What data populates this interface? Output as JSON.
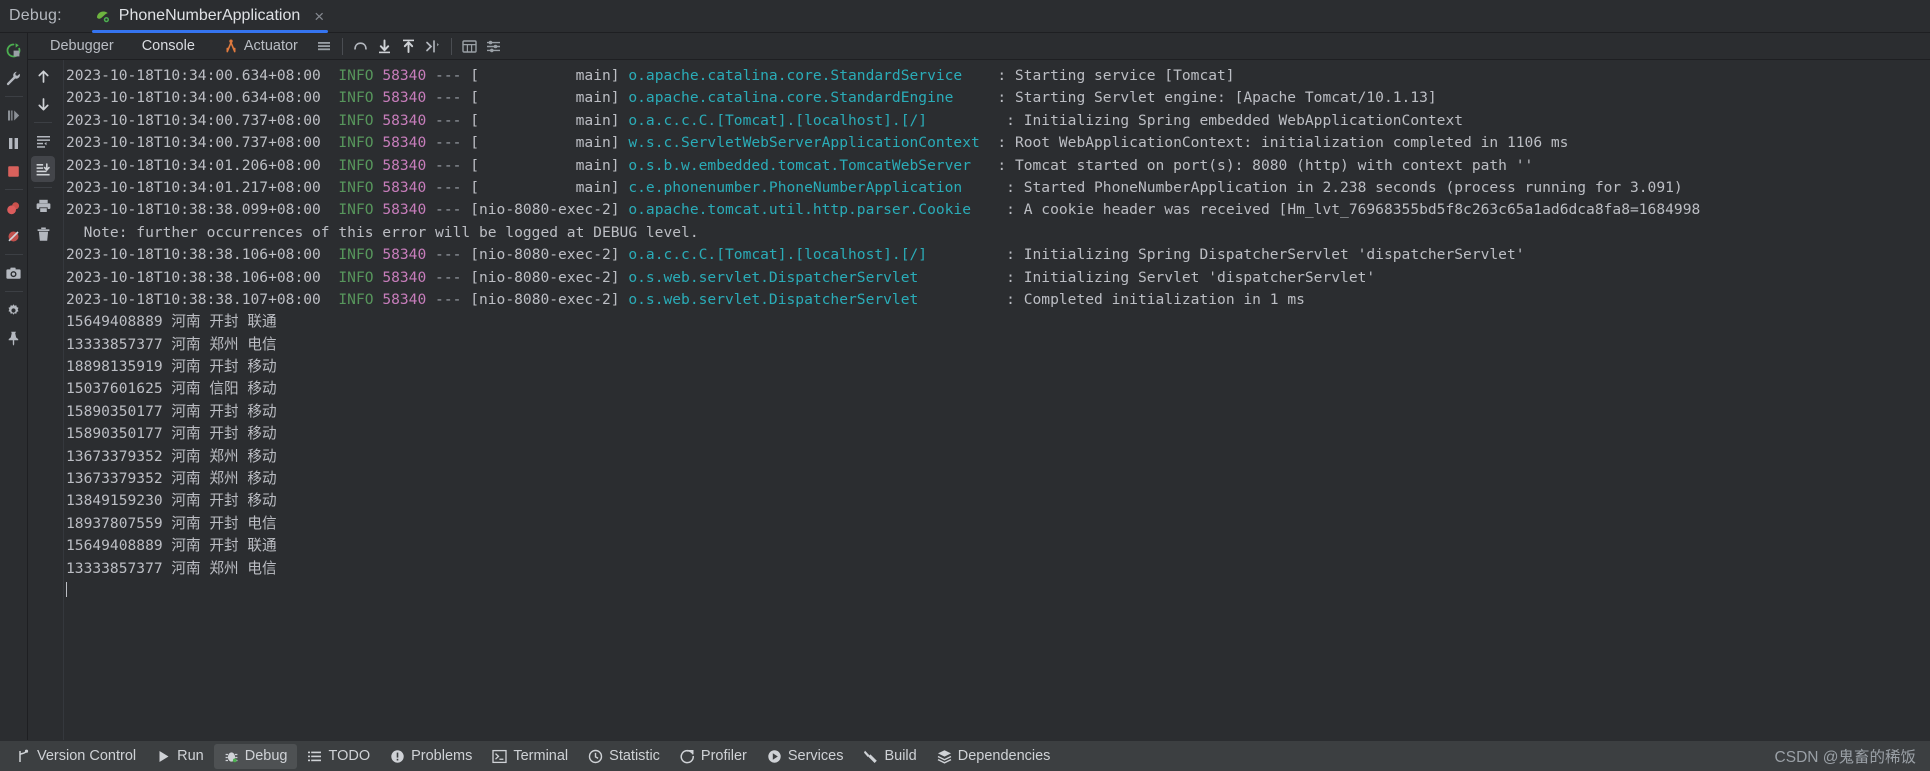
{
  "window": {
    "debug_label": "Debug:",
    "run_config_name": "PhoneNumberApplication",
    "close_glyph": "×"
  },
  "left_rail": {
    "items": [
      {
        "name": "rerun-debug-icon",
        "title": "Rerun"
      },
      {
        "name": "edit-configurations-icon",
        "title": "Edit Configurations"
      },
      {
        "name": "resume-program-icon",
        "title": "Resume Program"
      },
      {
        "name": "pause-program-icon",
        "title": "Pause Program"
      },
      {
        "name": "stop-icon",
        "title": "Stop"
      },
      {
        "name": "view-breakpoints-icon",
        "title": "View Breakpoints"
      },
      {
        "name": "mute-breakpoints-icon",
        "title": "Mute Breakpoints"
      },
      {
        "name": "screenshot-icon",
        "title": "Screenshot"
      },
      {
        "name": "settings-gear-icon",
        "title": "Settings"
      },
      {
        "name": "pin-icon",
        "title": "Pin Tab"
      }
    ]
  },
  "console_rail": {
    "items": [
      {
        "name": "up-arrow-icon",
        "title": "Previous Occurrence"
      },
      {
        "name": "down-arrow-icon",
        "title": "Next Occurrence"
      },
      {
        "name": "soft-wrap-icon",
        "title": "Soft-Wrap"
      },
      {
        "name": "scroll-to-end-icon",
        "title": "Scroll to the end",
        "active": true
      },
      {
        "name": "print-icon",
        "title": "Print"
      },
      {
        "name": "trash-icon",
        "title": "Clear All"
      }
    ]
  },
  "toolbar": {
    "tabs": [
      {
        "label": "Debugger",
        "name": "tab-debugger",
        "selected": false
      },
      {
        "label": "Console",
        "name": "tab-console",
        "selected": true
      },
      {
        "label": "Actuator",
        "name": "tab-actuator",
        "selected": false,
        "icon": "actuator-icon"
      }
    ],
    "icons": [
      {
        "name": "menu-lines-icon",
        "title": "Layout Settings"
      },
      {
        "name": "step-over-icon",
        "title": "Step Over"
      },
      {
        "name": "step-into-icon",
        "title": "Step Into"
      },
      {
        "name": "step-out-icon",
        "title": "Step Out"
      },
      {
        "name": "run-to-cursor-icon",
        "title": "Run to Cursor"
      },
      {
        "name": "evaluate-expression-icon",
        "title": "Evaluate Expression"
      },
      {
        "name": "settings-sliders-icon",
        "title": "Settings"
      }
    ]
  },
  "console": {
    "log_lines": [
      {
        "ts": "2023-10-18T10:34:00.634+08:00",
        "level": "INFO",
        "pid": "58340",
        "dash": "---",
        "thread": "[           main]",
        "logger": "o.apache.catalina.core.StandardService",
        "logger_pad": "   ",
        "msg": ": Starting service [Tomcat]"
      },
      {
        "ts": "2023-10-18T10:34:00.634+08:00",
        "level": "INFO",
        "pid": "58340",
        "dash": "---",
        "thread": "[           main]",
        "logger": "o.apache.catalina.core.StandardEngine",
        "logger_pad": "    ",
        "msg": ": Starting Servlet engine: [Apache Tomcat/10.1.13]"
      },
      {
        "ts": "2023-10-18T10:34:00.737+08:00",
        "level": "INFO",
        "pid": "58340",
        "dash": "---",
        "thread": "[           main]",
        "logger": "o.a.c.c.C.[Tomcat].[localhost].[/]",
        "logger_pad": "        ",
        "msg": ": Initializing Spring embedded WebApplicationContext"
      },
      {
        "ts": "2023-10-18T10:34:00.737+08:00",
        "level": "INFO",
        "pid": "58340",
        "dash": "---",
        "thread": "[           main]",
        "logger": "w.s.c.ServletWebServerApplicationContext",
        "logger_pad": " ",
        "msg": ": Root WebApplicationContext: initialization completed in 1106 ms"
      },
      {
        "ts": "2023-10-18T10:34:01.206+08:00",
        "level": "INFO",
        "pid": "58340",
        "dash": "---",
        "thread": "[           main]",
        "logger": "o.s.b.w.embedded.tomcat.TomcatWebServer",
        "logger_pad": "  ",
        "msg": ": Tomcat started on port(s): 8080 (http) with context path ''"
      },
      {
        "ts": "2023-10-18T10:34:01.217+08:00",
        "level": "INFO",
        "pid": "58340",
        "dash": "---",
        "thread": "[           main]",
        "logger": "c.e.phonenumber.PhoneNumberApplication",
        "logger_pad": "    ",
        "msg": ": Started PhoneNumberApplication in 2.238 seconds (process running for 3.091)"
      },
      {
        "ts": "2023-10-18T10:38:38.099+08:00",
        "level": "INFO",
        "pid": "58340",
        "dash": "---",
        "thread": "[nio-8080-exec-2]",
        "logger": "o.apache.tomcat.util.http.parser.Cookie",
        "logger_pad": "   ",
        "msg": ": A cookie header was received [Hm_lvt_76968355bd5f8c263c65a1ad6dca8fa8=1684998"
      },
      {
        "ts": "2023-10-18T10:38:38.106+08:00",
        "level": "INFO",
        "pid": "58340",
        "dash": "---",
        "thread": "[nio-8080-exec-2]",
        "logger": "o.a.c.c.C.[Tomcat].[localhost].[/]",
        "logger_pad": "        ",
        "msg": ": Initializing Spring DispatcherServlet 'dispatcherServlet'"
      },
      {
        "ts": "2023-10-18T10:38:38.106+08:00",
        "level": "INFO",
        "pid": "58340",
        "dash": "---",
        "thread": "[nio-8080-exec-2]",
        "logger": "o.s.web.servlet.DispatcherServlet",
        "logger_pad": "         ",
        "msg": ": Initializing Servlet 'dispatcherServlet'"
      },
      {
        "ts": "2023-10-18T10:38:38.107+08:00",
        "level": "INFO",
        "pid": "58340",
        "dash": "---",
        "thread": "[nio-8080-exec-2]",
        "logger": "o.s.web.servlet.DispatcherServlet",
        "logger_pad": "         ",
        "msg": ": Completed initialization in 1 ms"
      }
    ],
    "note_line": "  Note: further occurrences of this error will be logged at DEBUG level.",
    "note_after_index": 6,
    "output_lines": [
      "15649408889 河南 开封 联通",
      "13333857377 河南 郑州 电信",
      "18898135919 河南 开封 移动",
      "15037601625 河南 信阳 移动",
      "15890350177 河南 开封 移动",
      "15890350177 河南 开封 移动",
      "13673379352 河南 郑州 移动",
      "13673379352 河南 郑州 移动",
      "13849159230 河南 开封 移动",
      "18937807559 河南 开封 电信",
      "15649408889 河南 开封 联通",
      "13333857377 河南 郑州 电信"
    ]
  },
  "statusbar": {
    "items": [
      {
        "label": "Version Control",
        "name": "statusbar-version-control",
        "icon": "branch-icon",
        "selected": false
      },
      {
        "label": "Run",
        "name": "statusbar-run",
        "icon": "play-icon",
        "selected": false
      },
      {
        "label": "Debug",
        "name": "statusbar-debug",
        "icon": "bug-icon",
        "selected": true
      },
      {
        "label": "TODO",
        "name": "statusbar-todo",
        "icon": "list-icon",
        "selected": false
      },
      {
        "label": "Problems",
        "name": "statusbar-problems",
        "icon": "error-icon",
        "selected": false
      },
      {
        "label": "Terminal",
        "name": "statusbar-terminal",
        "icon": "terminal-icon",
        "selected": false
      },
      {
        "label": "Statistic",
        "name": "statusbar-statistic",
        "icon": "clock-icon",
        "selected": false
      },
      {
        "label": "Profiler",
        "name": "statusbar-profiler",
        "icon": "profiler-icon",
        "selected": false
      },
      {
        "label": "Services",
        "name": "statusbar-services",
        "icon": "services-icon",
        "selected": false
      },
      {
        "label": "Build",
        "name": "statusbar-build",
        "icon": "hammer-icon",
        "selected": false
      },
      {
        "label": "Dependencies",
        "name": "statusbar-dependencies",
        "icon": "layers-icon",
        "selected": false
      }
    ],
    "watermark": "CSDN @鬼畜的稀饭"
  },
  "colors": {
    "accent": "#3574f0",
    "level_info": "#57965c",
    "pid": "#c77dbb",
    "logger": "#2aacb8",
    "text": "#bcbec4",
    "bg": "#2b2d30",
    "statusbar_bg": "#3c3f41"
  }
}
